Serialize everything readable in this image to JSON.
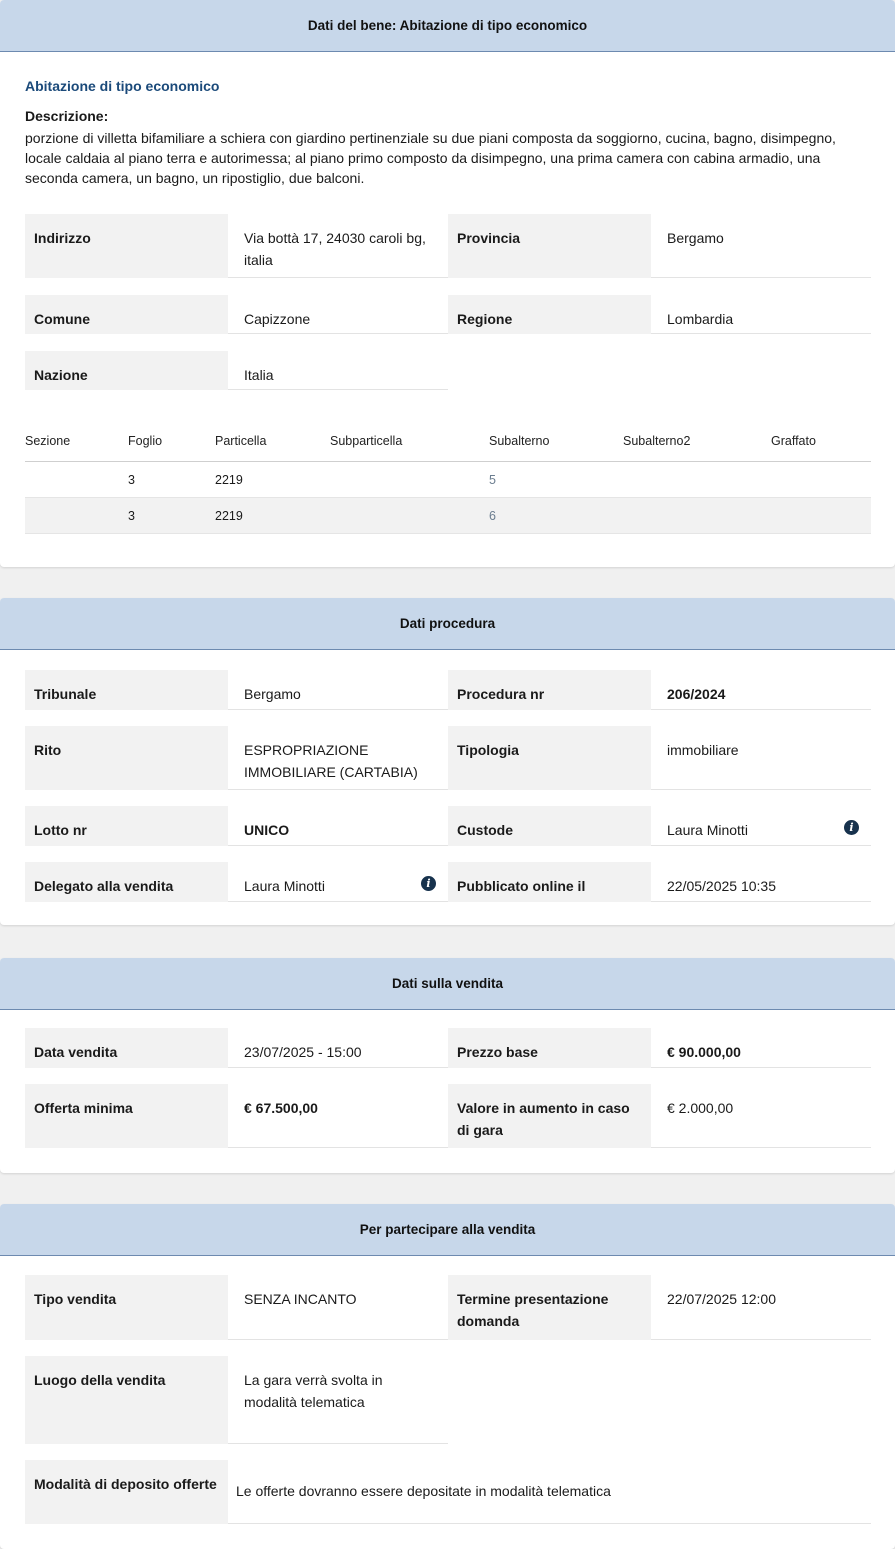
{
  "bene": {
    "header": "Dati del bene: Abitazione di tipo economico",
    "subtitle": "Abitazione di tipo economico",
    "desc_label": "Descrizione:",
    "desc_text": "porzione di villetta bifamiliare a schiera con giardino pertinenziale su due piani composta da soggiorno, cucina, bagno, disimpegno, locale caldaia al piano terra e autorimessa; al piano primo composto da disimpegno, una prima camera con cabina armadio, una seconda camera, un bagno, un ripostiglio, due balconi.",
    "indirizzo_label": "Indirizzo",
    "indirizzo_value": "Via bottà 17, 24030 caroli bg, italia",
    "provincia_label": "Provincia",
    "provincia_value": "Bergamo",
    "comune_label": "Comune",
    "comune_value": "Capizzone",
    "regione_label": "Regione",
    "regione_value": "Lombardia",
    "nazione_label": "Nazione",
    "nazione_value": "Italia",
    "catasto": {
      "headers": [
        "Sezione",
        "Foglio",
        "Particella",
        "Subparticella",
        "Subalterno",
        "Subalterno2",
        "Graffato"
      ],
      "rows": [
        [
          "",
          "3",
          "2219",
          "",
          "5",
          "",
          ""
        ],
        [
          "",
          "3",
          "2219",
          "",
          "6",
          "",
          ""
        ]
      ]
    }
  },
  "procedura": {
    "header": "Dati procedura",
    "tribunale_label": "Tribunale",
    "tribunale_value": "Bergamo",
    "procedura_label": "Procedura nr",
    "procedura_value": "206/2024",
    "rito_label": "Rito",
    "rito_value": "ESPROPRIAZIONE IMMOBILIARE (CARTABIA)",
    "tipologia_label": "Tipologia",
    "tipologia_value": "immobiliare",
    "lotto_label": "Lotto nr",
    "lotto_value": "UNICO",
    "custode_label": "Custode",
    "custode_value": "Laura Minotti",
    "delegato_label": "Delegato alla vendita",
    "delegato_value": "Laura Minotti",
    "pubblicato_label": "Pubblicato online il",
    "pubblicato_value": "22/05/2025 10:35"
  },
  "vendita": {
    "header": "Dati sulla vendita",
    "data_label": "Data vendita",
    "data_value": "23/07/2025 - 15:00",
    "prezzo_label": "Prezzo base",
    "prezzo_value": "€ 90.000,00",
    "offerta_label": "Offerta minima",
    "offerta_value": "€ 67.500,00",
    "aumento_label": "Valore in aumento in caso di gara",
    "aumento_value": "€ 2.000,00"
  },
  "partecipare": {
    "header": "Per partecipare alla vendita",
    "tipo_label": "Tipo vendita",
    "tipo_value": "SENZA INCANTO",
    "termine_label": "Termine presentazione domanda",
    "termine_value": "22/07/2025 12:00",
    "luogo_label": "Luogo della vendita",
    "luogo_value": "La gara verrà svolta in modalità telematica",
    "deposito_label": "Modalità di deposito offerte",
    "deposito_value": "Le offerte dovranno essere depositate in modalità telematica"
  },
  "icons": {
    "info": "info-icon"
  }
}
